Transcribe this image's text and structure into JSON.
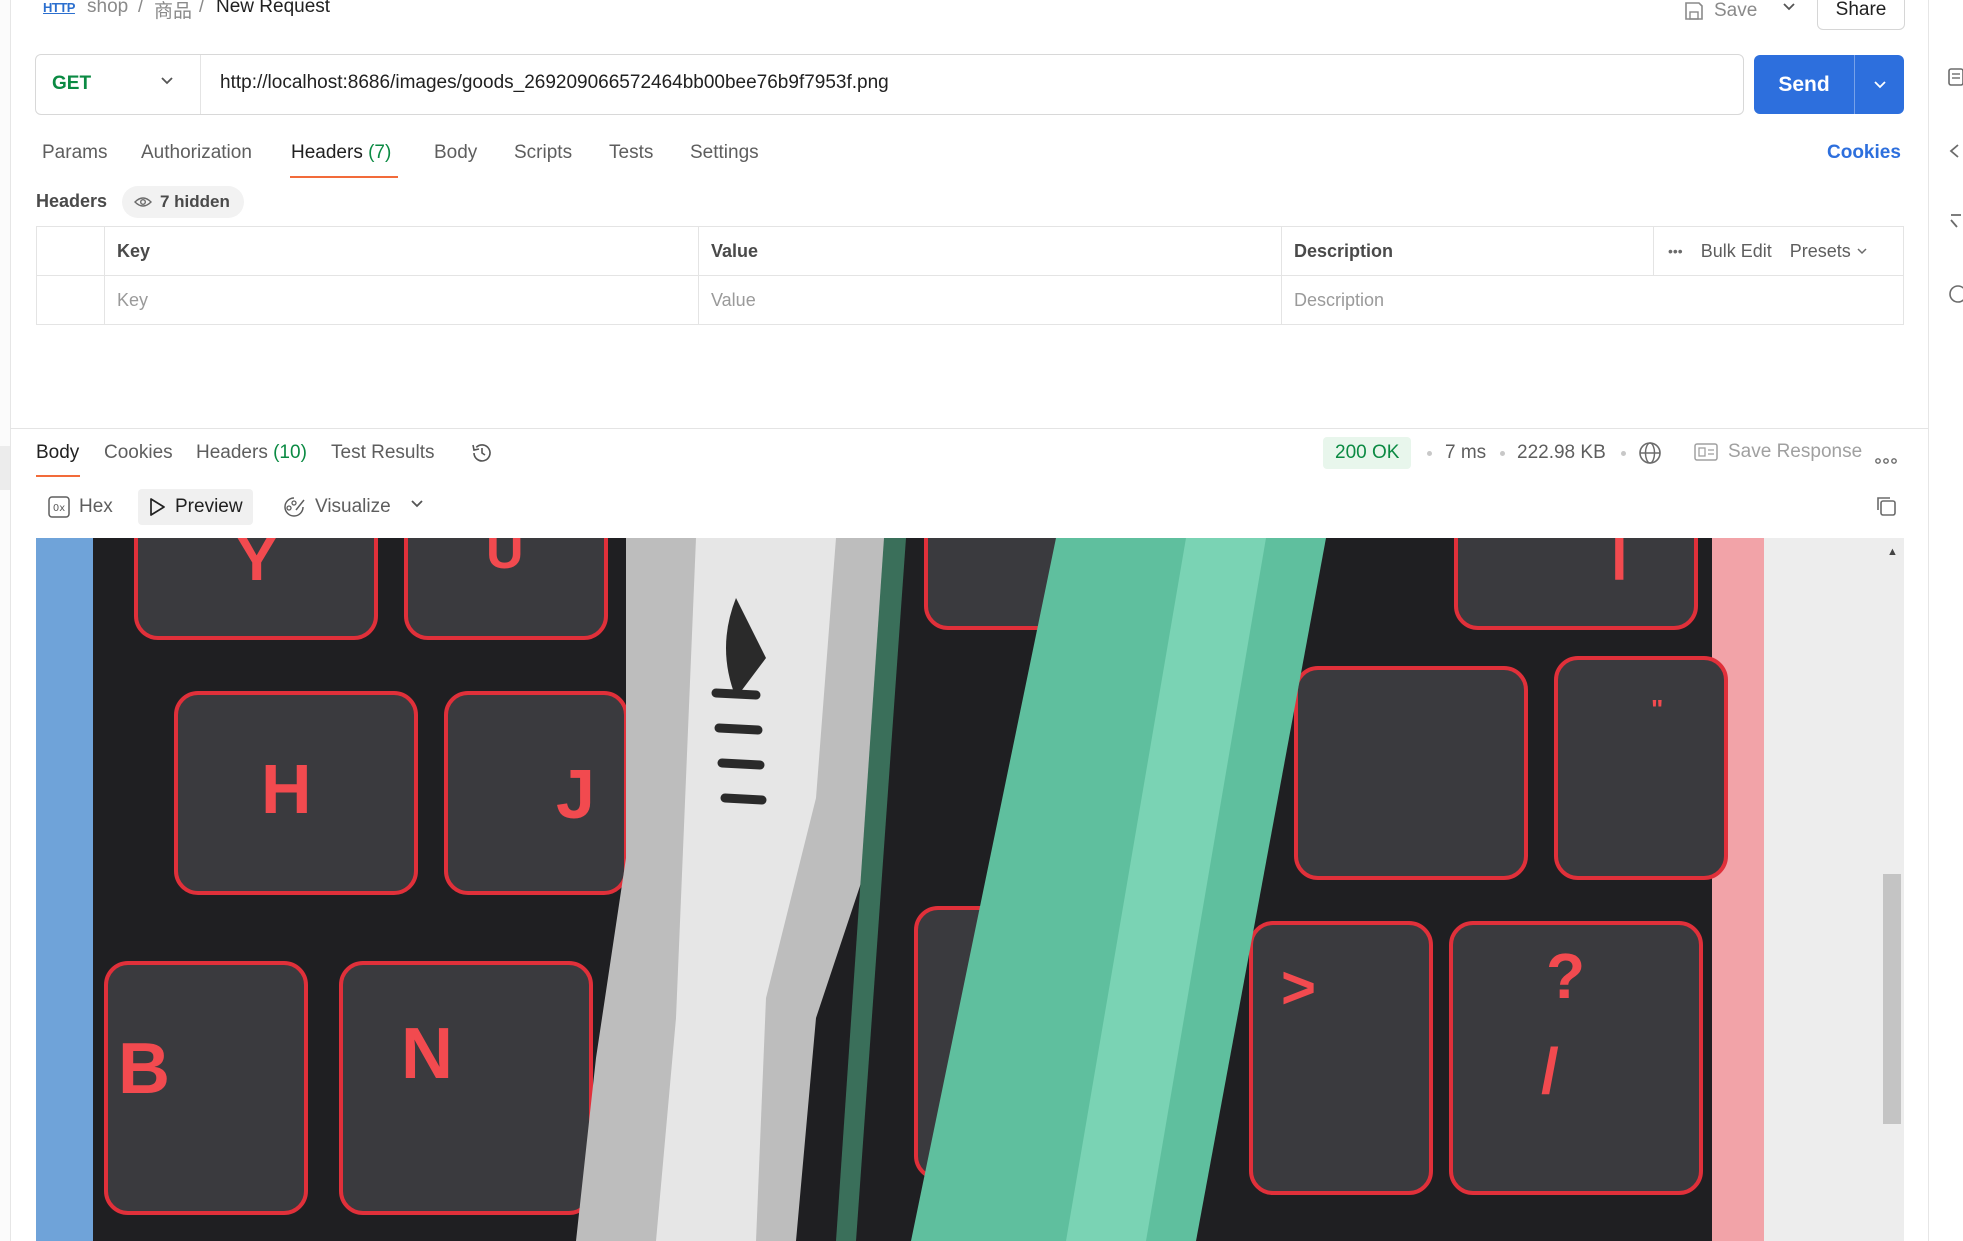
{
  "breadcrumb": {
    "badge": "HTTP",
    "items": [
      "shop",
      "商品",
      "New Request"
    ],
    "separator": "/"
  },
  "toolbar": {
    "save_label": "Save",
    "share_label": "Share"
  },
  "request": {
    "method": "GET",
    "url": "http://localhost:8686/images/goods_269209066572464bb00bee76b9f7953f.png",
    "send_label": "Send"
  },
  "request_tabs": [
    {
      "label": "Params"
    },
    {
      "label": "Authorization"
    },
    {
      "label": "Headers",
      "count": "(7)"
    },
    {
      "label": "Body"
    },
    {
      "label": "Scripts"
    },
    {
      "label": "Tests"
    },
    {
      "label": "Settings"
    }
  ],
  "cookies_label": "Cookies",
  "headers_section": {
    "title": "Headers",
    "hidden_badge": "7 hidden",
    "columns": [
      "Key",
      "Value",
      "Description"
    ],
    "placeholders": [
      "Key",
      "Value",
      "Description"
    ],
    "bulk_edit": "Bulk Edit",
    "presets": "Presets"
  },
  "response_tabs": [
    {
      "label": "Body"
    },
    {
      "label": "Cookies"
    },
    {
      "label": "Headers",
      "count": "(10)"
    },
    {
      "label": "Test Results"
    }
  ],
  "response_meta": {
    "status": "200 OK",
    "time": "7 ms",
    "size": "222.98 KB",
    "save_response": "Save Response"
  },
  "view_modes": {
    "hex": "Hex",
    "preview": "Preview",
    "visualize": "Visualize"
  },
  "colors": {
    "accent": "#2d6fdd",
    "method": "#0b8a43",
    "tab_underline": "#f26b3a"
  }
}
